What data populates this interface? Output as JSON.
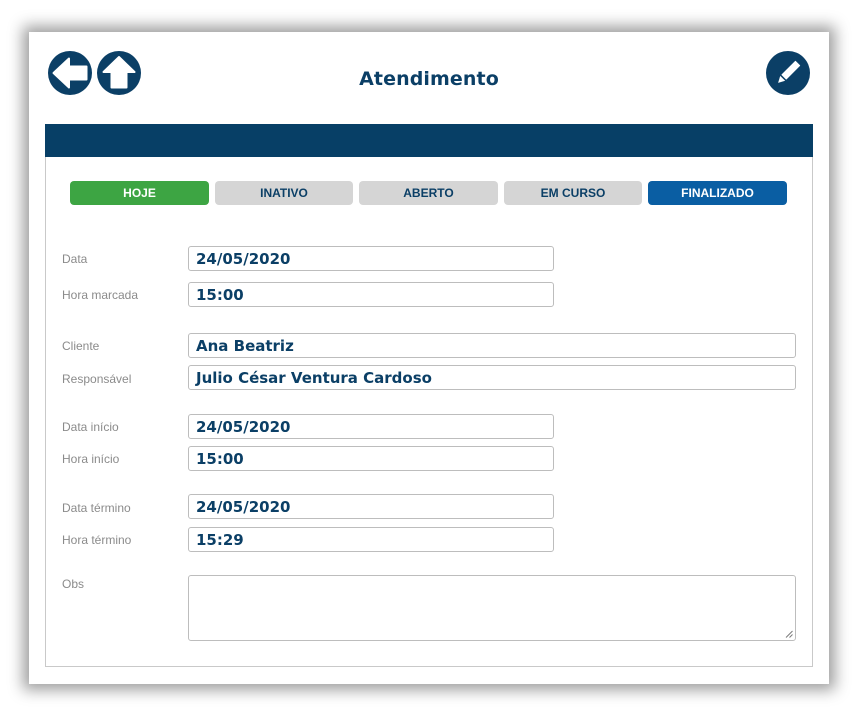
{
  "header": {
    "title": "Atendimento",
    "back_icon": "arrow-left-icon",
    "home_icon": "arrow-up-icon",
    "edit_icon": "pencil-icon"
  },
  "colors": {
    "primary": "#0b3f66",
    "banner": "#073f66",
    "today_tab": "#3da543",
    "active_tab": "#0a5ea3",
    "inactive_tab": "#d5d5d5",
    "label_text": "#8b8b8b"
  },
  "status_tabs": [
    {
      "label": "HOJE",
      "state": "today"
    },
    {
      "label": "INATIVO",
      "state": "inactive"
    },
    {
      "label": "ABERTO",
      "state": "inactive"
    },
    {
      "label": "EM CURSO",
      "state": "inactive"
    },
    {
      "label": "FINALIZADO",
      "state": "selected"
    }
  ],
  "form": {
    "data": {
      "label": "Data",
      "value": "24/05/2020"
    },
    "hora_marcada": {
      "label": "Hora marcada",
      "value": "15:00"
    },
    "cliente": {
      "label": "Cliente",
      "value": "Ana Beatriz"
    },
    "responsavel": {
      "label": "Responsável",
      "value": "Julio César Ventura Cardoso"
    },
    "data_inicio": {
      "label": "Data início",
      "value": "24/05/2020"
    },
    "hora_inicio": {
      "label": "Hora início",
      "value": "15:00"
    },
    "data_termino": {
      "label": "Data término",
      "value": "24/05/2020"
    },
    "hora_termino": {
      "label": "Hora término",
      "value": "15:29"
    },
    "obs": {
      "label": "Obs",
      "value": ""
    }
  }
}
